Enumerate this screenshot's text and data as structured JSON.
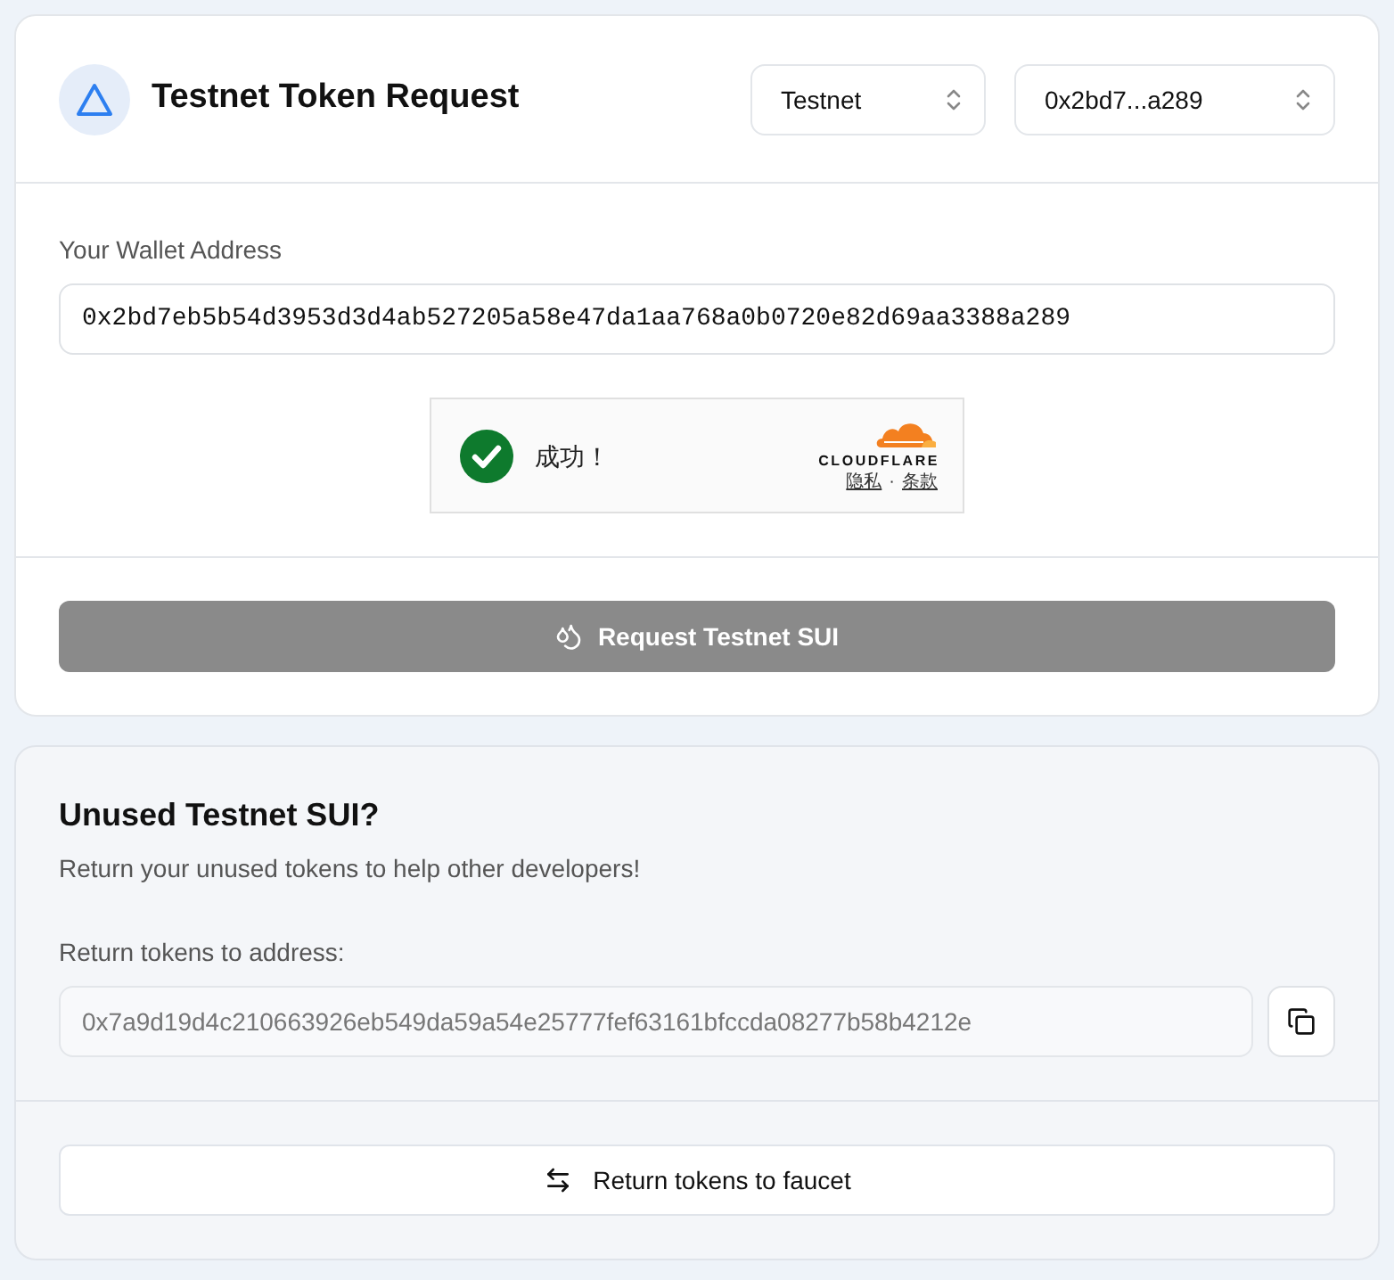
{
  "header": {
    "title": "Testnet Token Request",
    "network_select": {
      "value": "Testnet"
    },
    "account_select": {
      "value": "0x2bd7...a289"
    }
  },
  "request_form": {
    "address_label": "Your Wallet Address",
    "address_field": {
      "value": "0x2bd7eb5b54d3953d3d4ab527205a58e47da1aa768a0b0720e82d69aa3388a289"
    },
    "captcha": {
      "checked": true,
      "message": "成功！",
      "brand": "CLOUDFLARE",
      "links": [
        "隐私",
        "条款"
      ],
      "separator": "·"
    },
    "submit_button": {
      "label": "Request Testnet SUI",
      "disabled": true
    }
  },
  "return_section": {
    "title": "Unused Testnet SUI?",
    "description": "Return your unused tokens to help other developers!",
    "address_label": "Return tokens to address:",
    "address_field": {
      "value": "0x7a9d19d4c210663926eb549da59a54e25777fef63161bfccda08277b58b4212e",
      "disabled": true
    },
    "return_button": {
      "label": "Return tokens to faucet"
    }
  }
}
